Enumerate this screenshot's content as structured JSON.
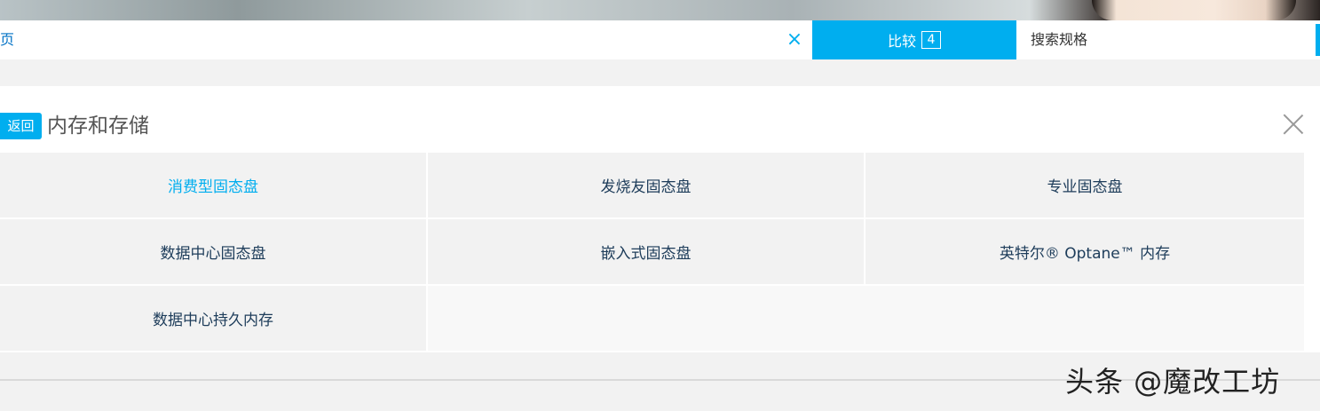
{
  "topbar": {
    "breadcrumb": "页",
    "clear_icon": "close-icon",
    "compare_label": "比较",
    "compare_count": "4",
    "spec_search_label": "搜索规格"
  },
  "panel": {
    "back_label": "返回",
    "title": "内存和存储",
    "close_icon": "close-icon",
    "categories": [
      {
        "label": "消费型固态盘",
        "active": true
      },
      {
        "label": "发烧友固态盘",
        "active": false
      },
      {
        "label": "专业固态盘",
        "active": false
      },
      {
        "label": "数据中心固态盘",
        "active": false
      },
      {
        "label": "嵌入式固态盘",
        "active": false
      },
      {
        "label": "英特尔® Optane™ 内存",
        "active": false
      },
      {
        "label": "数据中心持久内存",
        "active": false
      }
    ]
  },
  "watermark": "头条 @魔改工坊",
  "colors": {
    "accent": "#00aeef",
    "link": "#0071c5",
    "cell_text": "#1d3c5a"
  }
}
